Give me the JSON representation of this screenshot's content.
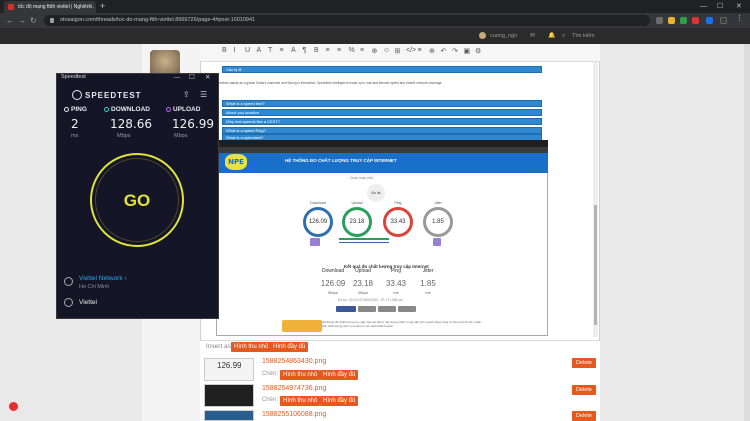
{
  "browser": {
    "tab_title": "tốc độ mạng fttth viettel | Nghiên...",
    "new_tab": "+",
    "url": "otosaigon.com/threads/toc-do-mang-ftth-viettel.8969726/page-4#post-10010941",
    "win_min": "—",
    "win_max": "☐",
    "win_close": "✕"
  },
  "site": {
    "user": "cuong_ngo",
    "search": "Tìm kiếm"
  },
  "editor": {
    "toolbar_icons": [
      "B",
      "I",
      "U",
      "A",
      "T",
      "≡",
      "A",
      "¶",
      "B",
      "≡",
      "≡",
      "%",
      "≡",
      "⊕",
      "☺",
      "⊞",
      "</>",
      "≡",
      "⊕",
      "↶",
      "↷",
      "▣",
      "⚙"
    ],
    "blue_rows": [
      "Vào tỷ lệ",
      "What is a speed test?",
      "About you location",
      "Why test speeds like a CEST?",
      "What is a speed Flag?",
      "What is a speedtest?"
    ],
    "para": "Speedtest stands as a global Ookla's customer and Sanng is interaction. Speedtest Intelligence leads up to how fast internet speed and mobile network coverage."
  },
  "speedtest_site": {
    "logo": "NPE",
    "title": "HỆ THỐNG ĐO CHẤT LƯỢNG TRUY CẬP INTERNET",
    "server_label": "Chọn máy chủ:",
    "go_small": "Đo lại",
    "gauges": [
      {
        "label": "Download",
        "value": "126.09",
        "unit": "Mbps",
        "color": "#2e6fb0"
      },
      {
        "label": "Upload",
        "value": "23.18",
        "unit": "Mbps",
        "color": "#29a05a"
      },
      {
        "label": "Ping",
        "value": "33.43",
        "unit": "ms",
        "color": "#d9443b"
      },
      {
        "label": "Jitter",
        "value": "1.85",
        "unit": "ms",
        "color": "#999999"
      }
    ],
    "result_title": "Kết quả đo chất lượng truy cập Internet",
    "result_sub": "Đo lúc: 15:24:33 24/04/2020 - IP: 171.248.xxx",
    "table_headers": [
      "Download",
      "Upload",
      "Ping",
      "Jitter"
    ],
    "table_values": [
      "126.09",
      "23.18",
      "33.43",
      "1.85"
    ],
    "table_units": [
      "Mbps",
      "Mbps",
      "ms",
      "ms"
    ],
    "footer_text": "Hệ thống đo chất lượng truy cập Internet được xây dựng nhằm cung cấp cho người dùng công cụ kiểm tra tốc độ, phản ánh chất lượng dịch vụ Internet một cách khách quan."
  },
  "attachments": {
    "insert_label": "Insert as:",
    "thumb_btn": "Hình thu nhỏ",
    "full_btn": "Hình đầy đủ",
    "chen_label": "Chèn:",
    "delete": "Delete",
    "files": [
      "1588254863430.png",
      "1588254974736.png",
      "1588255106088.png"
    ]
  },
  "speedtest_app": {
    "window_title": "Speedtest",
    "logo": "SPEEDTEST",
    "ping_label": "PING",
    "download_label": "DOWNLOAD",
    "upload_label": "UPLOAD",
    "ping_value": "2",
    "download_value": "128.66",
    "upload_value": "126.99",
    "ping_unit": "ms",
    "download_unit": "Mbps",
    "upload_unit": "Mbps",
    "go": "GO",
    "network": "Viettel Network ›",
    "city": "Ho Chi Minh",
    "isp": "Viettel",
    "colors": {
      "ping": "#e9e9ef",
      "download": "#38d1c6",
      "upload": "#b86cf0",
      "go": "#e4e33a"
    }
  }
}
